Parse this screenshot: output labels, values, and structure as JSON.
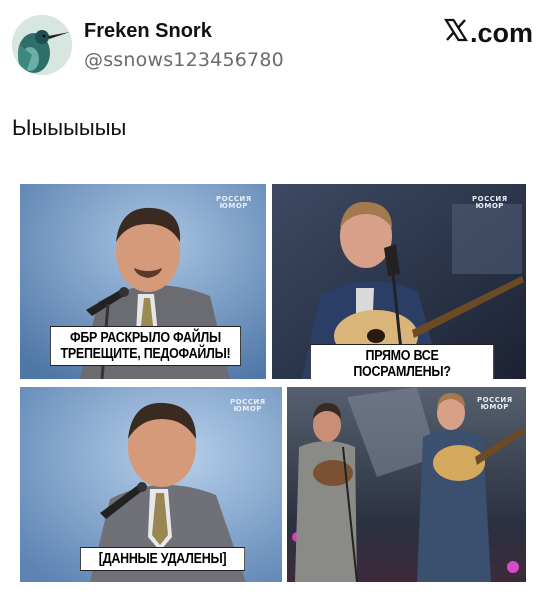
{
  "author": {
    "name": "Freken Snork",
    "handle": "@ssnows123456780"
  },
  "source": {
    "icon": "x-logo-icon",
    "text": ".com"
  },
  "post": {
    "text": "Ыыыыыыы"
  },
  "meme": {
    "panels": [
      {
        "caption_line1": "ФБР РАСКРЫЛО ФАЙЛЫ",
        "caption_line2": "ТРЕПЕЩИТЕ, ПЕДОФАЙЛЫ!",
        "logo_line1": "РОССИЯ",
        "logo_line2": "ЮМОР"
      },
      {
        "caption": "ПРЯМО ВСЕ ПОСРАМЛЕНЫ?",
        "logo_line1": "РОССИЯ",
        "logo_line2": "ЮМОР"
      },
      {
        "caption": "[ДАННЫЕ УДАЛЕНЫ]",
        "logo_line1": "РОССИЯ",
        "logo_line2": "ЮМОР"
      },
      {
        "logo_line1": "РОССИЯ",
        "logo_line2": "ЮМОР"
      }
    ]
  },
  "colors": {
    "stage_blue": "#6f93bf",
    "suit_gray": "#6e7078",
    "dark_stage": "#2a3346",
    "caption_bg": "#ffffff"
  }
}
